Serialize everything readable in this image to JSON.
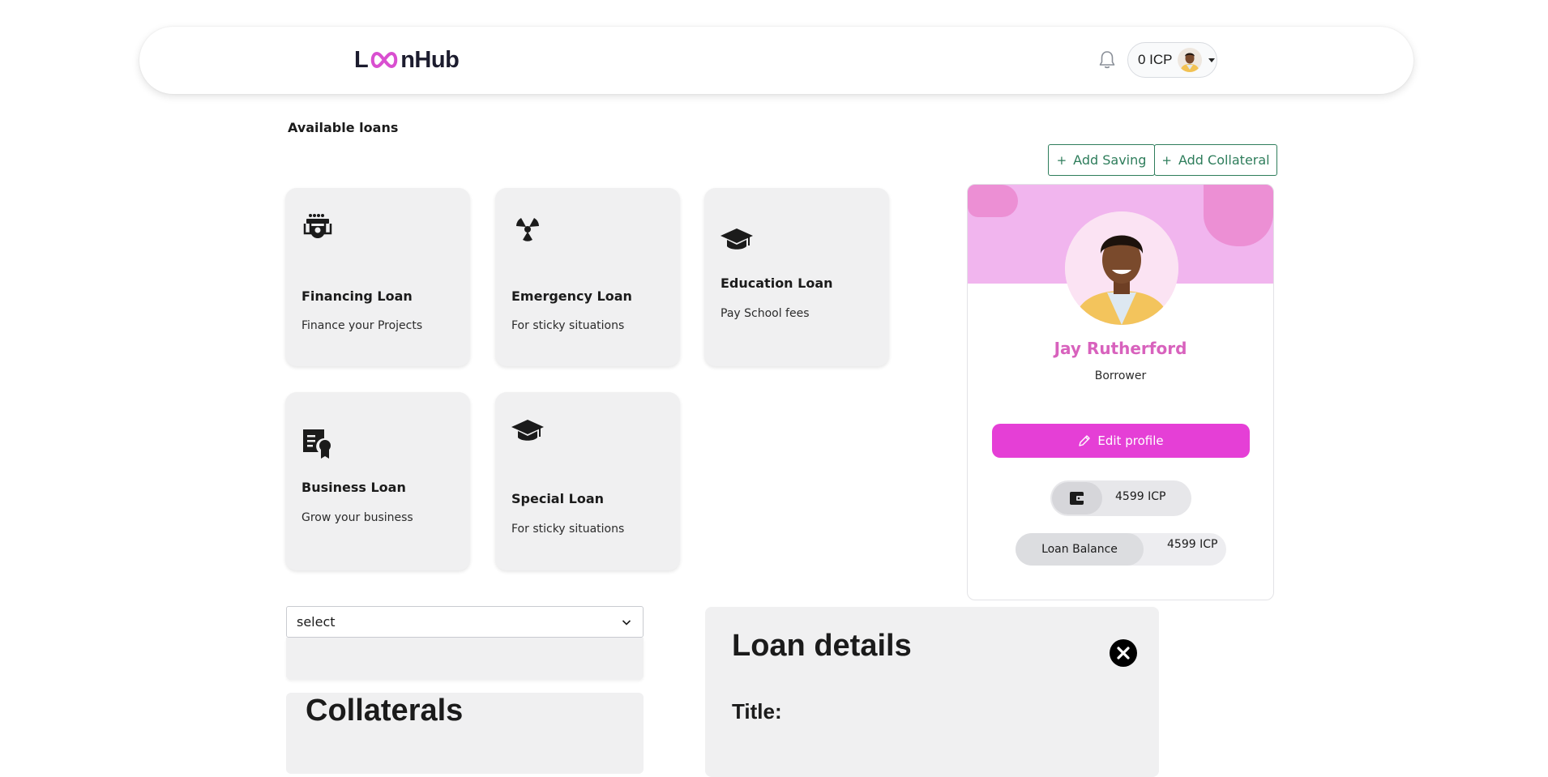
{
  "header": {
    "logo_text_left": "L",
    "logo_text_right": "nHub",
    "wallet_balance": "0 ICP"
  },
  "available_loans": {
    "title": "Available loans",
    "cards": [
      {
        "title": "Financing Loan",
        "description": "Finance your Projects",
        "icon": "financing-icon"
      },
      {
        "title": "Emergency Loan",
        "description": "For sticky situations",
        "icon": "emergency-icon"
      },
      {
        "title": "Education Loan",
        "description": "Pay School fees",
        "icon": "graduation-cap-icon"
      },
      {
        "title": "Business Loan",
        "description": "Grow your business",
        "icon": "certificate-icon"
      },
      {
        "title": "Special Loan",
        "description": "For sticky situations",
        "icon": "graduation-cap-icon"
      }
    ]
  },
  "actions": {
    "add_saving": "Add Saving",
    "add_collateral": "Add Collateral"
  },
  "profile": {
    "name": "Jay Rutherford",
    "role": "Borrower",
    "edit_label": "Edit profile",
    "wallet_balance": "4599 ICP",
    "loan_balance_label": "Loan Balance",
    "loan_balance_value": "4599 ICP"
  },
  "collaterals": {
    "select_value": "select",
    "title": "Collaterals"
  },
  "loan_details": {
    "title": "Loan details",
    "title_label": "Title:"
  },
  "colors": {
    "accent_pink": "#e53fd6",
    "name_pink": "#d862bd",
    "banner_pink": "#f1b5ee",
    "blob_pink": "#ec8fd4",
    "action_green": "#2e7d5b"
  }
}
